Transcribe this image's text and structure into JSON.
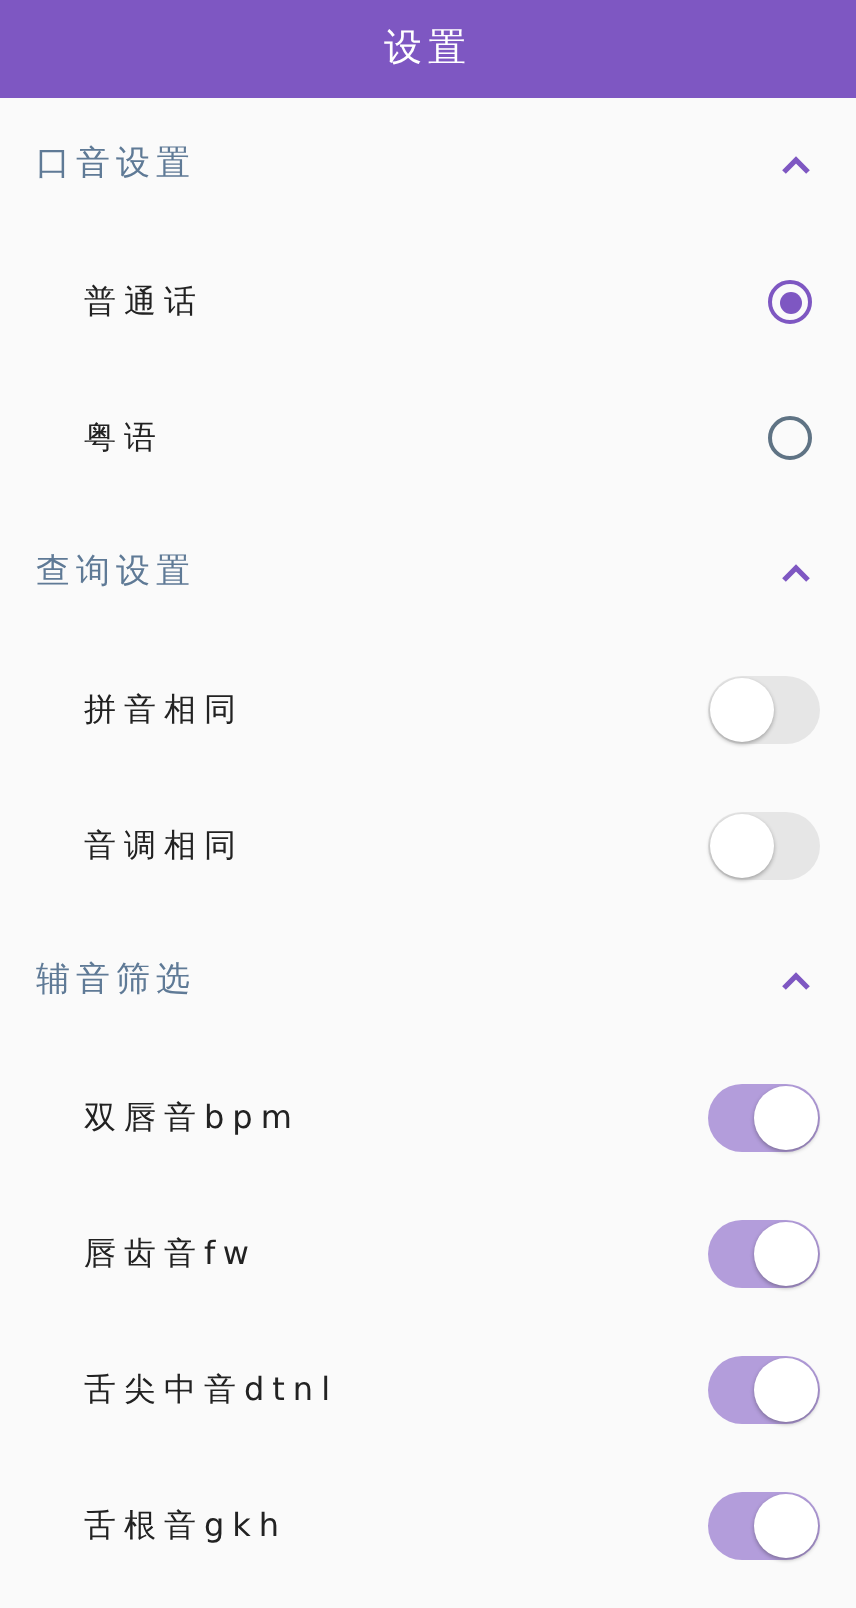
{
  "app_bar": {
    "title": "设置"
  },
  "sections": [
    {
      "title": "口音设置",
      "expanded": true,
      "items": [
        {
          "kind": "radio",
          "label": "普通话",
          "selected": true
        },
        {
          "kind": "radio",
          "label": "粤语",
          "selected": false
        }
      ]
    },
    {
      "title": "查询设置",
      "expanded": true,
      "items": [
        {
          "kind": "switch",
          "label": "拼音相同",
          "on": false
        },
        {
          "kind": "switch",
          "label": "音调相同",
          "on": false
        }
      ]
    },
    {
      "title": "辅音筛选",
      "expanded": true,
      "items": [
        {
          "kind": "switch",
          "label": "双唇音bpm",
          "on": true
        },
        {
          "kind": "switch",
          "label": "唇齿音fw",
          "on": true
        },
        {
          "kind": "switch",
          "label": "舌尖中音dtnl",
          "on": true
        },
        {
          "kind": "switch",
          "label": "舌根音gkh",
          "on": true
        }
      ]
    }
  ]
}
